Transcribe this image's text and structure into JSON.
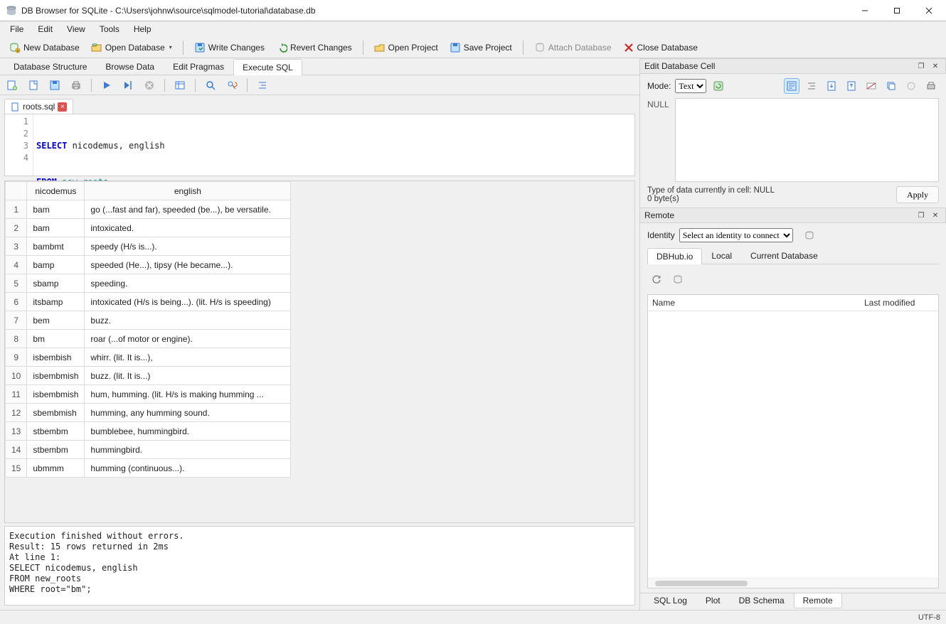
{
  "window": {
    "title": "DB Browser for SQLite - C:\\Users\\johnw\\source\\sqlmodel-tutorial\\database.db"
  },
  "menu": {
    "items": [
      "File",
      "Edit",
      "View",
      "Tools",
      "Help"
    ]
  },
  "toolbar": {
    "new_db": "New Database",
    "open_db": "Open Database",
    "write_changes": "Write Changes",
    "revert_changes": "Revert Changes",
    "open_project": "Open Project",
    "save_project": "Save Project",
    "attach_db": "Attach Database",
    "close_db": "Close Database"
  },
  "main_tabs": {
    "items": [
      "Database Structure",
      "Browse Data",
      "Edit Pragmas",
      "Execute SQL"
    ],
    "active": 3
  },
  "file_tab": {
    "name": "roots.sql"
  },
  "sql": {
    "line1_kw": "SELECT",
    "line1_rest": " nicodemus, english",
    "line2_kw": "FROM",
    "line2_ident": " new_roots",
    "line3_kw": "WHERE",
    "line3_ident": " root",
    "line3_eq": "=",
    "line3_str": "\"bm\"",
    "line3_end": ";"
  },
  "results": {
    "headers": [
      "nicodemus",
      "english"
    ],
    "rows": [
      {
        "n": "1",
        "nicodemus": "bam",
        "english": "go (...fast and far), speeded (be...), be versatile."
      },
      {
        "n": "2",
        "nicodemus": "bam",
        "english": "intoxicated."
      },
      {
        "n": "3",
        "nicodemus": "bambmt",
        "english": "speedy (H/s is...)."
      },
      {
        "n": "4",
        "nicodemus": "bamp",
        "english": "speeded (He...), tipsy (He became...)."
      },
      {
        "n": "5",
        "nicodemus": "sbamp",
        "english": "speeding."
      },
      {
        "n": "6",
        "nicodemus": "itsbamp",
        "english": "intoxicated (H/s is being...). (lit. H/s is speeding)"
      },
      {
        "n": "7",
        "nicodemus": "bem",
        "english": "buzz."
      },
      {
        "n": "8",
        "nicodemus": "bm",
        "english": "roar (...of motor or engine)."
      },
      {
        "n": "9",
        "nicodemus": "isbembish",
        "english": "whirr. (lit. It is...),"
      },
      {
        "n": "10",
        "nicodemus": "isbembmish",
        "english": "buzz. (lit. It is...)"
      },
      {
        "n": "11",
        "nicodemus": "isbembmish",
        "english": "hum, humming. (lit. H/s is making humming ..."
      },
      {
        "n": "12",
        "nicodemus": "sbembmish",
        "english": "humming, any humming sound."
      },
      {
        "n": "13",
        "nicodemus": "stbembm",
        "english": "bumblebee, hummingbird."
      },
      {
        "n": "14",
        "nicodemus": "stbembm",
        "english": "hummingbird."
      },
      {
        "n": "15",
        "nicodemus": "ubmmm",
        "english": "humming (continuous...)."
      }
    ]
  },
  "log": "Execution finished without errors.\nResult: 15 rows returned in 2ms\nAt line 1:\nSELECT nicodemus, english\nFROM new_roots\nWHERE root=\"bm\";",
  "edit_cell": {
    "title": "Edit Database Cell",
    "mode_label": "Mode:",
    "mode_value": "Text",
    "null_label": "NULL",
    "type_info": "Type of data currently in cell: NULL",
    "size_info": "0 byte(s)",
    "apply": "Apply"
  },
  "remote": {
    "title": "Remote",
    "identity_label": "Identity",
    "identity_value": "Select an identity to connect",
    "tabs": [
      "DBHub.io",
      "Local",
      "Current Database"
    ],
    "active_tab": 0,
    "col_name": "Name",
    "col_modified": "Last modified"
  },
  "bottom_tabs": {
    "items": [
      "SQL Log",
      "Plot",
      "DB Schema",
      "Remote"
    ],
    "active": 3
  },
  "status": {
    "encoding": "UTF-8"
  }
}
